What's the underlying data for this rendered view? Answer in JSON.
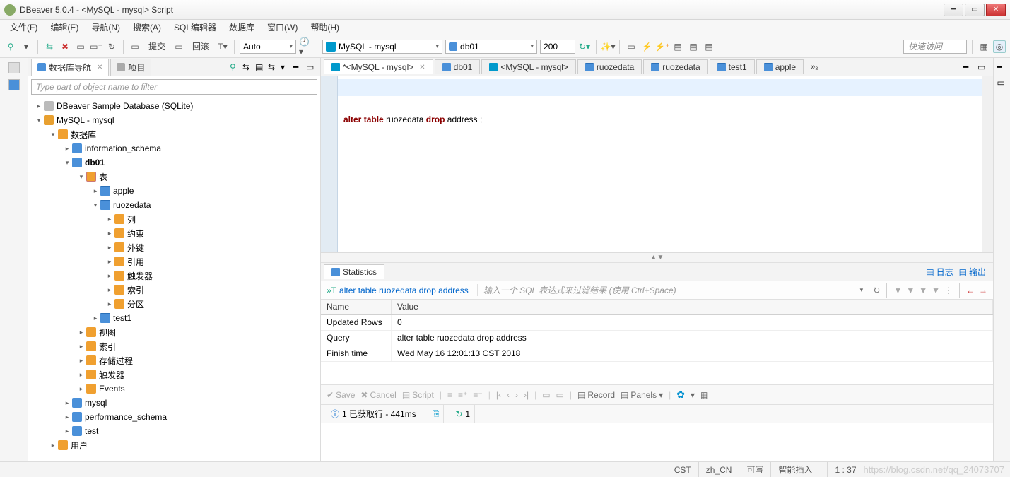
{
  "window": {
    "title": "DBeaver 5.0.4 - <MySQL - mysql> Script"
  },
  "menu": [
    "文件(F)",
    "编辑(E)",
    "导航(N)",
    "搜索(A)",
    "SQL编辑器",
    "数据库",
    "窗口(W)",
    "帮助(H)"
  ],
  "toolbar": {
    "commit": "提交",
    "rollback": "回滚",
    "auto": "Auto",
    "conn_label": "MySQL - mysql",
    "db_label": "db01",
    "limit": "200",
    "quick_access": "快速访问"
  },
  "left": {
    "tabs": {
      "nav": "数据库导航",
      "proj": "项目"
    },
    "filter_placeholder": "Type part of object name to filter",
    "tree": {
      "sample_db": "DBeaver Sample Database (SQLite)",
      "mysql_conn": "MySQL - mysql",
      "databases": "数据库",
      "info_schema": "information_schema",
      "db01": "db01",
      "tables": "表",
      "apple": "apple",
      "ruozedata": "ruozedata",
      "columns": "列",
      "constraints": "约束",
      "fkeys": "外键",
      "refs": "引用",
      "triggers_t": "触发器",
      "indexes_t": "索引",
      "partitions": "分区",
      "test1": "test1",
      "views": "视图",
      "indexes": "索引",
      "procs": "存储过程",
      "triggers": "触发器",
      "events": "Events",
      "mysql_db": "mysql",
      "perf_schema": "performance_schema",
      "test_db": "test",
      "users": "用户"
    }
  },
  "editor_tabs": [
    {
      "label": "*<MySQL - mysql>",
      "icon": "sql",
      "active": true,
      "closable": true
    },
    {
      "label": "db01",
      "icon": "db",
      "closable": false
    },
    {
      "label": "<MySQL - mysql>",
      "icon": "sql",
      "closable": false
    },
    {
      "label": "ruozedata",
      "icon": "tbl",
      "closable": false
    },
    {
      "label": "ruozedata",
      "icon": "tbl",
      "closable": false
    },
    {
      "label": "test1",
      "icon": "tbl",
      "closable": false
    },
    {
      "label": "apple",
      "icon": "tbl",
      "closable": false
    }
  ],
  "more_tabs": "»₃",
  "sql": {
    "kw1": "alter",
    "kw2": "table",
    "id1": "ruozedata",
    "kw3": "drop",
    "id2": "address ;"
  },
  "results": {
    "tab": "Statistics",
    "log_link": "日志",
    "out_link": "输出",
    "exec_query": "alter table ruozedata drop address",
    "filter_hint": "输入一个 SQL 表达式来过滤结果 (使用 Ctrl+Space)",
    "cols": [
      "Name",
      "Value"
    ],
    "rows": [
      {
        "Name": "Updated Rows",
        "Value": "0"
      },
      {
        "Name": "Query",
        "Value": "alter table ruozedata drop address"
      },
      {
        "Name": "Finish time",
        "Value": "Wed May 16 12:01:13 CST 2018"
      }
    ],
    "toolbar": {
      "save": "Save",
      "cancel": "Cancel",
      "script": "Script",
      "record": "Record",
      "panels": "Panels"
    },
    "status": {
      "info": "1 已获取行 - 441ms",
      "refresh_count": "1"
    }
  },
  "statusbar": {
    "tz": "CST",
    "locale": "zh_CN",
    "rw": "可写",
    "insert": "智能插入",
    "cursor": "1 : 37"
  },
  "watermark": "https://blog.csdn.net/qq_24073707"
}
